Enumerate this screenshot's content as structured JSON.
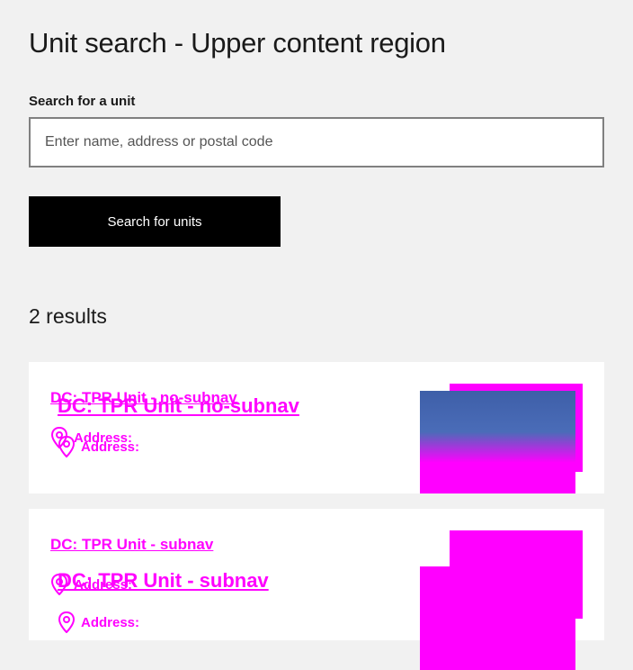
{
  "page": {
    "title": "Unit search - Upper content region"
  },
  "search": {
    "label": "Search for a unit",
    "placeholder": "Enter name, address or postal code",
    "value": "",
    "button_label": "Search for units"
  },
  "results": {
    "count_label": "2 results",
    "items": [
      {
        "title": "DC: TPR Unit - no-subnav",
        "title_ghost": "DC: TPR Unit - no-subnav",
        "address_label": "Address:",
        "address_label_ghost": "Address:"
      },
      {
        "title": "DC: TPR Unit - subnav",
        "title_ghost": "DC: TPR Unit - subnav",
        "address_label": "Address:",
        "address_label_ghost": "Address:"
      }
    ]
  },
  "colors": {
    "background": "#f1f1f1",
    "button": "#000000",
    "accent": "#ff00ff"
  },
  "icons": {
    "address": "location-pin-icon"
  }
}
